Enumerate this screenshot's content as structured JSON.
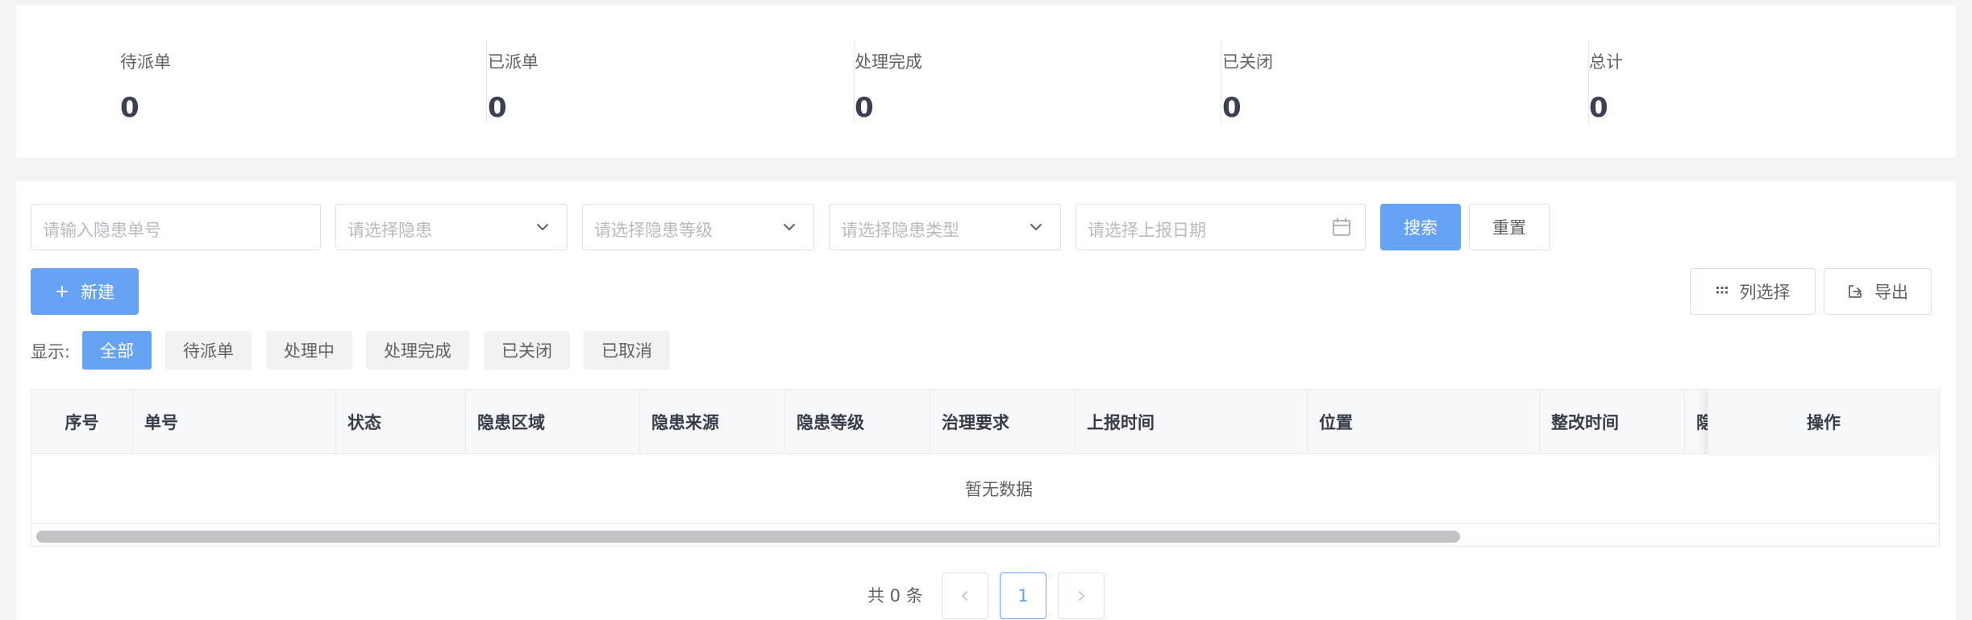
{
  "stats": [
    {
      "label": "待派单",
      "value": "0"
    },
    {
      "label": "已派单",
      "value": "0"
    },
    {
      "label": "处理完成",
      "value": "0"
    },
    {
      "label": "已关闭",
      "value": "0"
    },
    {
      "label": "总计",
      "value": "0"
    }
  ],
  "search": {
    "order_no_placeholder": "请输入隐患单号",
    "hazard_placeholder": "请选择隐患",
    "level_placeholder": "请选择隐患等级",
    "type_placeholder": "请选择隐患类型",
    "date_placeholder": "请选择上报日期",
    "search_label": "搜索",
    "reset_label": "重置"
  },
  "toolbar": {
    "new_label": "新建",
    "columns_label": "列选择",
    "export_label": "导出"
  },
  "filter": {
    "label": "显示:",
    "chips": [
      "全部",
      "待派单",
      "处理中",
      "处理完成",
      "已关闭",
      "已取消"
    ],
    "active": "全部"
  },
  "table": {
    "columns": [
      "序号",
      "单号",
      "状态",
      "隐患区域",
      "隐患来源",
      "隐患等级",
      "治理要求",
      "上报时间",
      "位置",
      "整改时间",
      "隐"
    ],
    "action_column": "操作",
    "empty_text": "暂无数据",
    "scroll_fraction": 0.75
  },
  "pagination": {
    "total_text": "共 0 条",
    "current_page": "1"
  },
  "colors": {
    "primary": "#66a3f5",
    "background": "#f3f4f6"
  },
  "icons": {
    "select": "chevron-down-icon",
    "date": "calendar-icon",
    "new": "plus-icon",
    "columns": "grid-icon",
    "export": "export-icon",
    "prev": "chevron-left-icon",
    "next": "chevron-right-icon"
  }
}
